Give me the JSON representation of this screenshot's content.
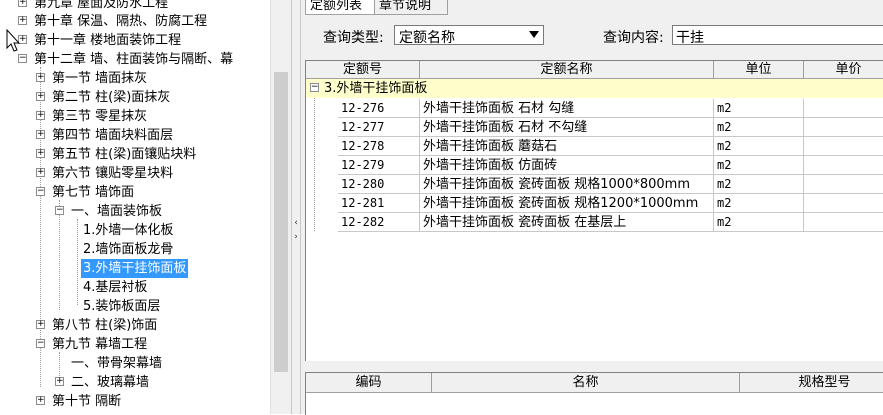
{
  "tree": {
    "nodes": [
      {
        "label": "第九章 屋面及防水工程",
        "toggle": "+"
      },
      {
        "label": "第十章 保温、隔热、防腐工程",
        "toggle": "+"
      },
      {
        "label": "第十一章 楼地面装饰工程",
        "toggle": "+"
      },
      {
        "label": "第十二章 墙、柱面装饰与隔断、幕",
        "toggle": "−"
      },
      {
        "label": "第一节 墙面抹灰",
        "toggle": "+"
      },
      {
        "label": "第二节 柱(梁)面抹灰",
        "toggle": "+"
      },
      {
        "label": "第三节 零星抹灰",
        "toggle": "+"
      },
      {
        "label": "第四节 墙面块料面层",
        "toggle": "+"
      },
      {
        "label": "第五节 柱(梁)面镶贴块料",
        "toggle": "+"
      },
      {
        "label": "第六节 镶贴零星块料",
        "toggle": "+"
      },
      {
        "label": "第七节 墙饰面",
        "toggle": "−"
      },
      {
        "label": "一、墙面装饰板",
        "toggle": "−"
      },
      {
        "label": "1.外墙一体化板",
        "toggle": ""
      },
      {
        "label": "2.墙饰面板龙骨",
        "toggle": ""
      },
      {
        "label": "3.外墙干挂饰面板",
        "toggle": ""
      },
      {
        "label": "4.基层衬板",
        "toggle": ""
      },
      {
        "label": "5.装饰板面层",
        "toggle": ""
      },
      {
        "label": "第八节 柱(梁)饰面",
        "toggle": "+"
      },
      {
        "label": "第九节 幕墙工程",
        "toggle": "−"
      },
      {
        "label": "一、带骨架幕墙",
        "toggle": ""
      },
      {
        "label": "二、玻璃幕墙",
        "toggle": "+"
      },
      {
        "label": "第十节 隔断",
        "toggle": "+"
      }
    ]
  },
  "tabs": [
    {
      "label": "定额列表"
    },
    {
      "label": "章节说明"
    }
  ],
  "query": {
    "type_label": "查询类型:",
    "type_value": "定额名称",
    "content_label": "查询内容:",
    "content_value": "干挂"
  },
  "grid1": {
    "headers": [
      "定额号",
      "定额名称",
      "单位",
      "单价"
    ],
    "group_label": "3.外墙干挂饰面板",
    "group_toggle": "−",
    "rows": [
      {
        "code": "12-276",
        "name": "外墙干挂饰面板 石材 勾缝",
        "unit": "m2"
      },
      {
        "code": "12-277",
        "name": "外墙干挂饰面板 石材 不勾缝",
        "unit": "m2"
      },
      {
        "code": "12-278",
        "name": "外墙干挂饰面板 蘑菇石",
        "unit": "m2"
      },
      {
        "code": "12-279",
        "name": "外墙干挂饰面板 仿面砖",
        "unit": "m2"
      },
      {
        "code": "12-280",
        "name": "外墙干挂饰面板 瓷砖面板 规格1000*800mm",
        "unit": "m2"
      },
      {
        "code": "12-281",
        "name": "外墙干挂饰面板 瓷砖面板 规格1200*1000mm",
        "unit": "m2"
      },
      {
        "code": "12-282",
        "name": "外墙干挂饰面板 瓷砖面板 在基层上",
        "unit": "m2"
      }
    ]
  },
  "grid2": {
    "headers": [
      "编码",
      "名称",
      "规格型号"
    ]
  },
  "scroll": {
    "left": "‹",
    "right": "›"
  },
  "colors": {
    "selection": "#3399ff",
    "group_row": "#ffffcc",
    "header": "#f0f0f0"
  }
}
